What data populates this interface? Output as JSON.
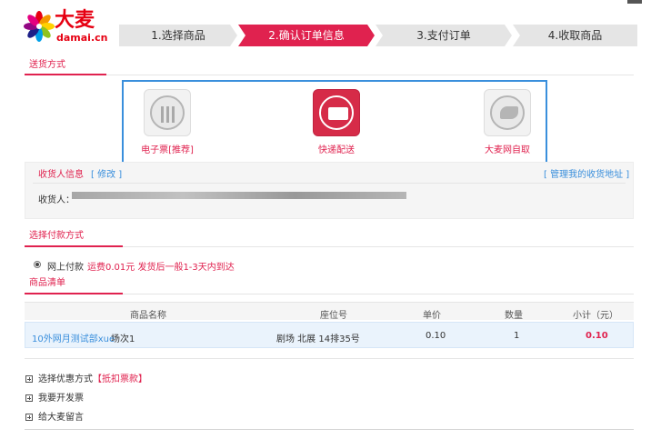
{
  "header": {
    "logo_text": "大麦",
    "logo_domain": "damai.cn",
    "steps": [
      "1.选择商品",
      "2.确认订单信息",
      "3.支付订单",
      "4.收取商品"
    ],
    "accent_color": "#e0224f",
    "selection_color": "#3a8fdc"
  },
  "delivery": {
    "title": "送货方式",
    "options": [
      {
        "label": "电子票[推荐]",
        "icon": "qrcode-icon"
      },
      {
        "label": "快递配送",
        "icon": "truck-icon",
        "selected": true
      },
      {
        "label": "大麦网自取",
        "icon": "hand-ticket-icon"
      }
    ]
  },
  "receiver": {
    "title": "收货人信息",
    "edit": "[ 修改 ]",
    "manage": "[ 管理我的收货地址 ]",
    "name_label": "收货人："
  },
  "payment": {
    "title": "选择付款方式",
    "option_label": "网上付款",
    "note": "运费0.01元 发货后一般1-3天内到达"
  },
  "items": {
    "title": "商品清单",
    "columns": [
      "商品名称",
      "座位号",
      "单价",
      "数量",
      "小计（元）"
    ],
    "rows": [
      {
        "name": "10外网月测试部xue",
        "session": "场次1",
        "seat": "剧场 北展 14排35号",
        "price": "0.10",
        "qty": "1",
        "subtotal": "0.10"
      }
    ]
  },
  "extras": {
    "coupon_label": "选择优惠方式",
    "coupon_highlight": "【抵扣票款】",
    "invoice_label": "我要开发票",
    "message_label": "给大麦留言"
  }
}
